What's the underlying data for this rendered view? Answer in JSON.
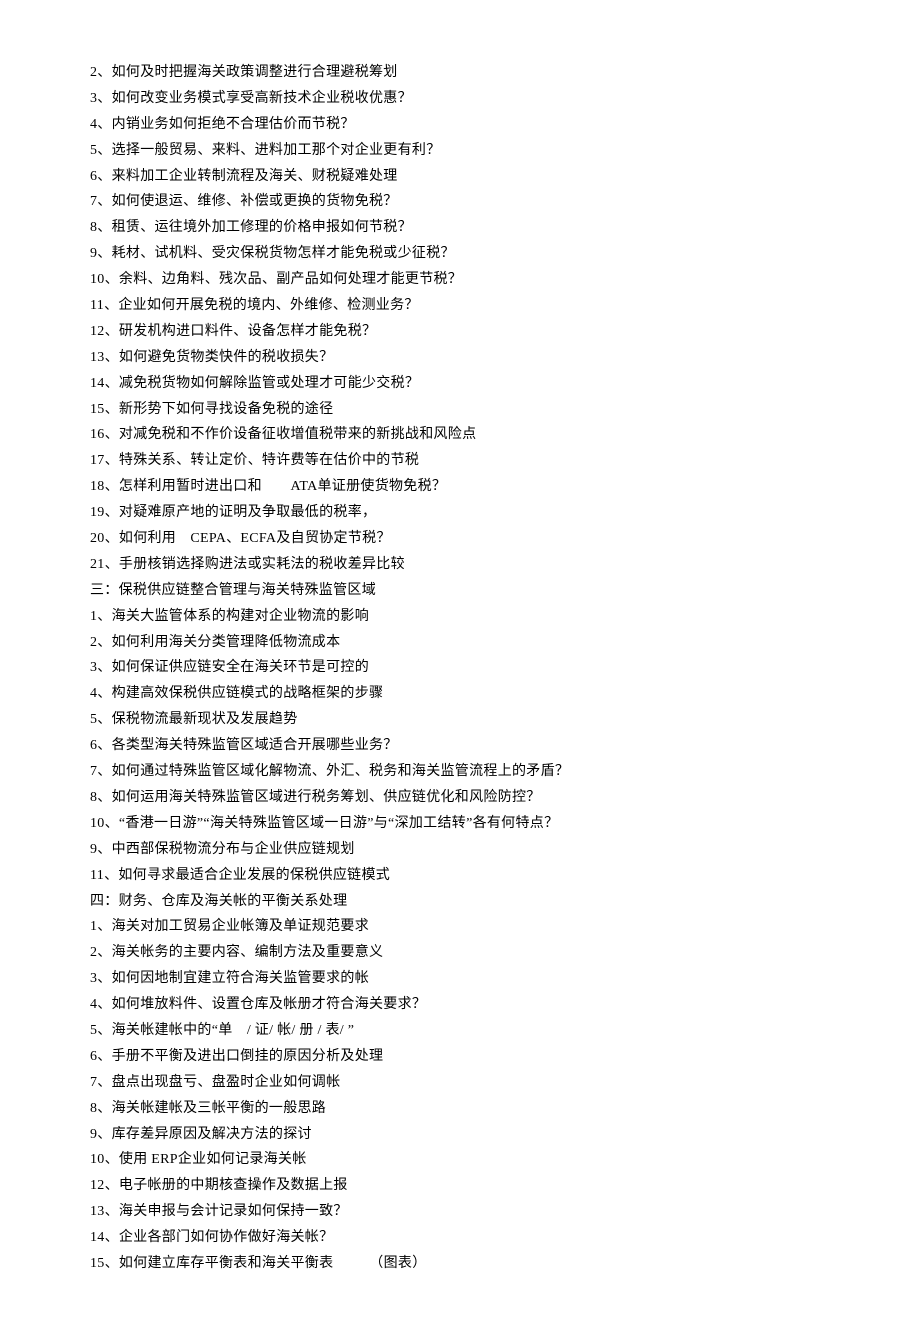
{
  "lines": [
    "2、如何及时把握海关政策调整进行合理避税筹划",
    "3、如何改变业务模式享受高新技术企业税收优惠？",
    "4、内销业务如何拒绝不合理估价而节税？",
    "5、选择一般贸易、来料、进料加工那个对企业更有利？",
    "6、来料加工企业转制流程及海关、财税疑难处理",
    "7、如何使退运、维修、补偿或更换的货物免税？",
    "8、租赁、运往境外加工修理的价格申报如何节税？",
    "9、耗材、试机料、受灾保税货物怎样才能免税或少征税？",
    "10、余料、边角料、残次品、副产品如何处理才能更节税？",
    "11、企业如何开展免税的境内、外维修、检测业务？",
    "12、研发机构进口料件、设备怎样才能免税？",
    "13、如何避免货物类快件的税收损失？",
    "14、减免税货物如何解除监管或处理才可能少交税？",
    "15、新形势下如何寻找设备免税的途径",
    "16、对减免税和不作价设备征收增值税带来的新挑战和风险点",
    "17、特殊关系、转让定价、特许费等在估价中的节税",
    "18、怎样利用暂时进出口和　　ATA单证册使货物免税？",
    "19、对疑难原产地的证明及争取最低的税率，",
    "20、如何利用　CEPA、ECFA及自贸协定节税？",
    "21、手册核销选择购进法或实耗法的税收差异比较",
    "三：保税供应链整合管理与海关特殊监管区域",
    "1、海关大监管体系的构建对企业物流的影响",
    "2、如何利用海关分类管理降低物流成本",
    "3、如何保证供应链安全在海关环节是可控的",
    "4、构建高效保税供应链模式的战略框架的步骤",
    "5、保税物流最新现状及发展趋势",
    "6、各类型海关特殊监管区域适合开展哪些业务？",
    "7、如何通过特殊监管区域化解物流、外汇、税务和海关监管流程上的矛盾？",
    "8、如何运用海关特殊监管区域进行税务筹划、供应链优化和风险防控？",
    "10、“香港一日游”“海关特殊监管区域一日游”与“深加工结转”各有何特点？",
    "9、中西部保税物流分布与企业供应链规划",
    "11、如何寻求最适合企业发展的保税供应链模式",
    "四：财务、仓库及海关帐的平衡关系处理",
    "1、海关对加工贸易企业帐簿及单证规范要求",
    "2、海关帐务的主要内容、编制方法及重要意义",
    "3、如何因地制宜建立符合海关监管要求的帐",
    "4、如何堆放料件、设置仓库及帐册才符合海关要求？",
    "5、海关帐建帐中的“单　/ 证/ 帐/ 册 / 表/ ”",
    "6、手册不平衡及进出口倒挂的原因分析及处理",
    "7、盘点出现盘亏、盘盈时企业如何调帐",
    "8、海关帐建帐及三帐平衡的一般思路",
    "9、库存差异原因及解决方法的探讨",
    "10、使用 ERP企业如何记录海关帐",
    "12、电子帐册的中期核查操作及数据上报",
    "13、海关申报与会计记录如何保持一致？",
    "14、企业各部门如何协作做好海关帐？",
    "15、如何建立库存平衡表和海关平衡表　　　（图表）"
  ]
}
